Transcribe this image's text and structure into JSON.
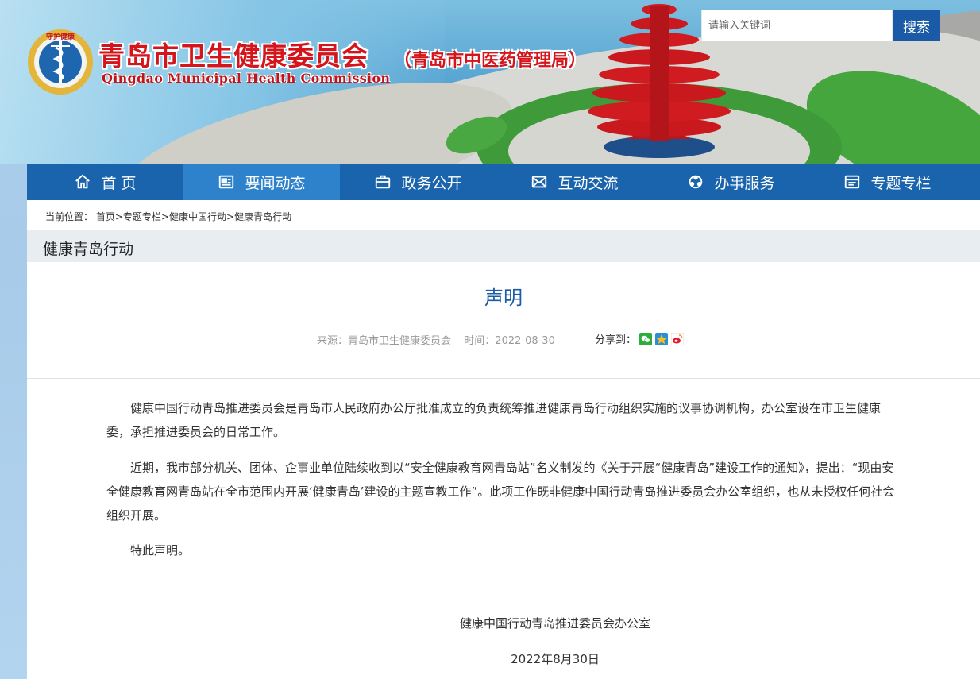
{
  "header": {
    "site_name_cn": "青岛市卫生健康委员会",
    "site_sub_cn": "（青岛市中医药管理局）",
    "site_name_en": "Qingdao Municipal Health Commission",
    "logo_ring_text": "守护健康",
    "search": {
      "placeholder": "请输入关键词",
      "button": "搜索"
    }
  },
  "nav": {
    "items": [
      {
        "label": "首 页",
        "icon": "home-icon"
      },
      {
        "label": "要闻动态",
        "icon": "news-icon"
      },
      {
        "label": "政务公开",
        "icon": "briefcase-icon"
      },
      {
        "label": "互动交流",
        "icon": "mail-icon"
      },
      {
        "label": "办事服务",
        "icon": "service-icon"
      },
      {
        "label": "专题专栏",
        "icon": "column-icon"
      }
    ],
    "active_index": 1
  },
  "breadcrumb": {
    "prefix": "当前位置：",
    "items": [
      "首页",
      "专题专栏",
      "健康中国行动",
      "健康青岛行动"
    ],
    "separator": ">"
  },
  "column": {
    "title": "健康青岛行动"
  },
  "article": {
    "title": "声明",
    "source": "来源：青岛市卫生健康委员会",
    "time": "时间：2022-08-30",
    "share_label": "分享到：",
    "share_icons": [
      "wechat-icon",
      "qzone-icon",
      "weibo-icon"
    ],
    "paragraphs": [
      "健康中国行动青岛推进委员会是青岛市人民政府办公厅批准成立的负责统筹推进健康青岛行动组织实施的议事协调机构，办公室设在市卫生健康委，承担推进委员会的日常工作。",
      "近期，我市部分机关、团体、企事业单位陆续收到以“安全健康教育网青岛站”名义制发的《关于开展“健康青岛”建设工作的通知》，提出：“现由安全健康教育网青岛站在全市范围内开展‘健康青岛’建设的主题宣教工作”。此项工作既非健康中国行动青岛推进委员会办公室组织，也从未授权任何社会组织开展。",
      "特此声明。"
    ],
    "signature": "健康中国行动青岛推进委员会办公室",
    "date": "2022年8月30日"
  },
  "colors": {
    "nav_bg": "#1a64ad",
    "nav_active": "#2e82cc",
    "title_blue": "#1b5aa7",
    "site_red": "#d4151b"
  }
}
